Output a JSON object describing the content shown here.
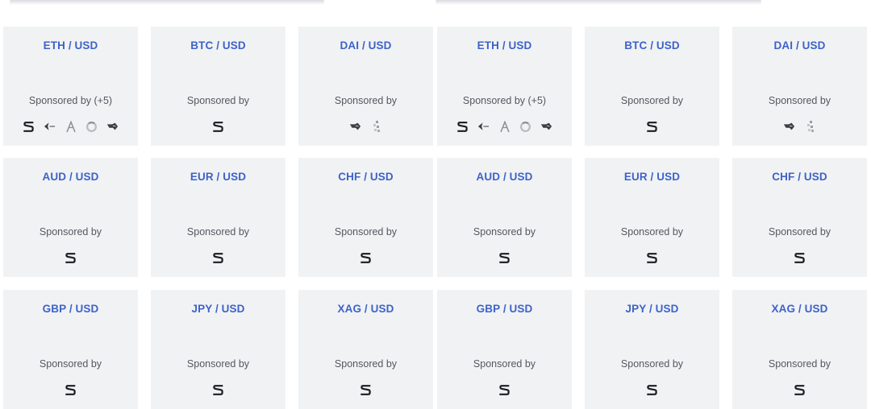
{
  "sponsor_label": "Sponsored by",
  "cards": [
    {
      "pair": "ETH / USD",
      "sponsor_text": "Sponsored by (+5)",
      "logos": [
        "s-logo-icon",
        "arrow-bird-icon",
        "compass-icon",
        "ring-icon",
        "hand-icon"
      ]
    },
    {
      "pair": "BTC / USD",
      "sponsor_text": "Sponsored by",
      "logos": [
        "s-logo-icon"
      ]
    },
    {
      "pair": "DAI / USD",
      "sponsor_text": "Sponsored by",
      "logos": [
        "hand-icon",
        "pixel-icon"
      ]
    },
    {
      "pair": "ETH / USD",
      "sponsor_text": "Sponsored by (+5)",
      "logos": [
        "s-logo-icon",
        "arrow-bird-icon",
        "compass-icon",
        "ring-icon",
        "hand-icon"
      ]
    },
    {
      "pair": "BTC / USD",
      "sponsor_text": "Sponsored by",
      "logos": [
        "s-logo-icon"
      ]
    },
    {
      "pair": "DAI / USD",
      "sponsor_text": "Sponsored by",
      "logos": [
        "hand-icon",
        "pixel-icon"
      ]
    },
    {
      "pair": "AUD / USD",
      "sponsor_text": "Sponsored by",
      "logos": [
        "s-logo-icon"
      ]
    },
    {
      "pair": "EUR / USD",
      "sponsor_text": "Sponsored by",
      "logos": [
        "s-logo-icon"
      ]
    },
    {
      "pair": "CHF / USD",
      "sponsor_text": "Sponsored by",
      "logos": [
        "s-logo-icon"
      ]
    },
    {
      "pair": "AUD / USD",
      "sponsor_text": "Sponsored by",
      "logos": [
        "s-logo-icon"
      ]
    },
    {
      "pair": "EUR / USD",
      "sponsor_text": "Sponsored by",
      "logos": [
        "s-logo-icon"
      ]
    },
    {
      "pair": "CHF / USD",
      "sponsor_text": "Sponsored by",
      "logos": [
        "s-logo-icon"
      ]
    },
    {
      "pair": "GBP / USD",
      "sponsor_text": "Sponsored by",
      "logos": [
        "s-logo-icon"
      ]
    },
    {
      "pair": "JPY / USD",
      "sponsor_text": "Sponsored by",
      "logos": [
        "s-logo-icon"
      ]
    },
    {
      "pair": "XAG / USD",
      "sponsor_text": "Sponsored by",
      "logos": [
        "s-logo-icon"
      ]
    },
    {
      "pair": "GBP / USD",
      "sponsor_text": "Sponsored by",
      "logos": [
        "s-logo-icon"
      ]
    },
    {
      "pair": "JPY / USD",
      "sponsor_text": "Sponsored by",
      "logos": [
        "s-logo-icon"
      ]
    },
    {
      "pair": "XAG / USD",
      "sponsor_text": "Sponsored by",
      "logos": [
        "s-logo-icon"
      ]
    }
  ],
  "colors": {
    "card_bg": "#f1f2f4",
    "pair_text": "#3d63c9",
    "sponsor_text": "#54575e"
  }
}
